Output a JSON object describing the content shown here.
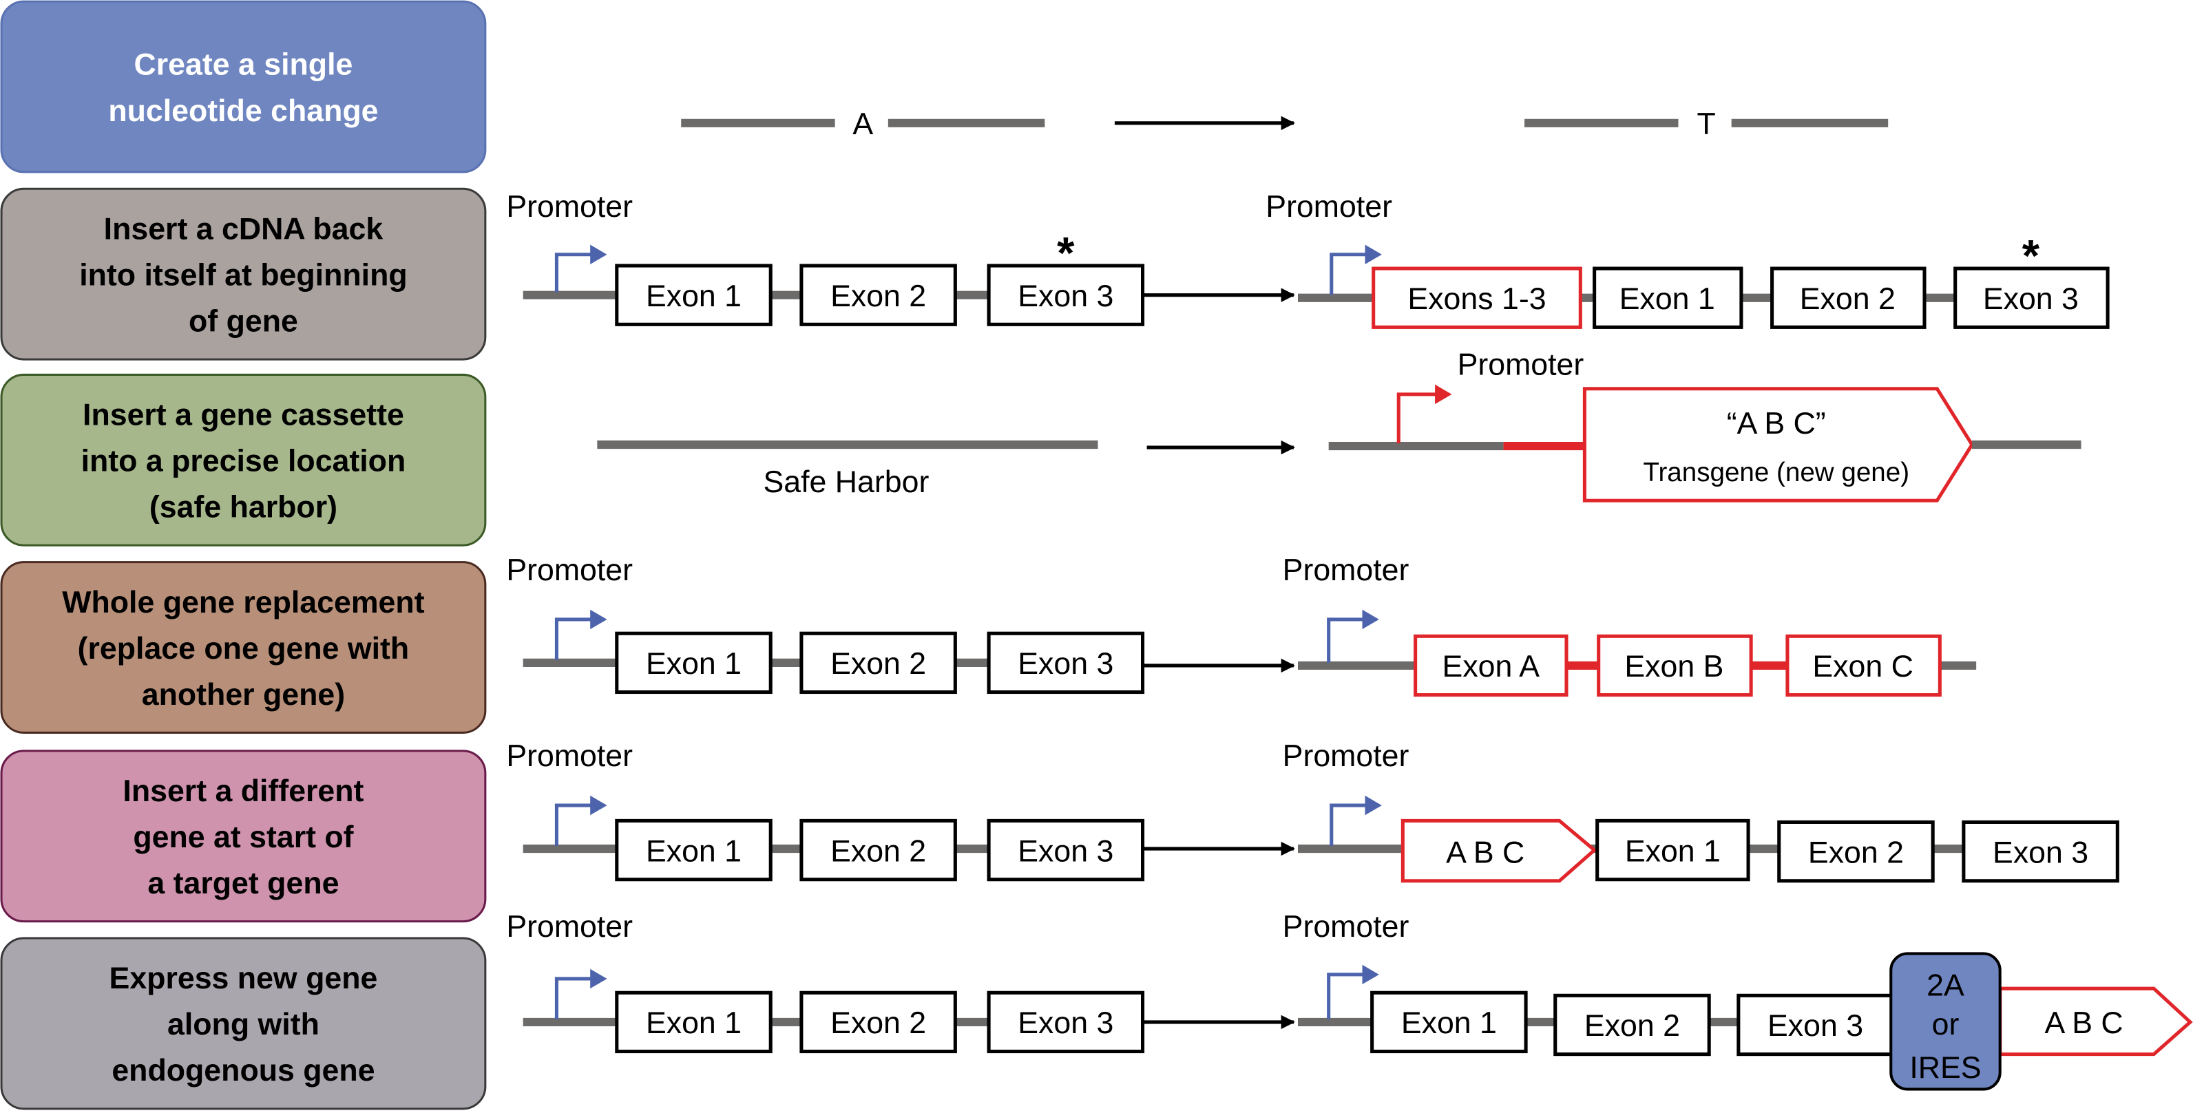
{
  "categories": [
    {
      "label_lines": [
        "Create a single",
        "nucleotide change"
      ],
      "fill": "#6f86c0",
      "stroke": "#5a72b2",
      "text_color": "#ffffff"
    },
    {
      "label_lines": [
        "Insert a cDNA back",
        "into itself at beginning",
        "of gene"
      ],
      "fill": "#aaa29f",
      "stroke": "#3a3a3a",
      "text_color": "#000000"
    },
    {
      "label_lines": [
        "Insert a gene cassette",
        "into a precise location",
        "(safe harbor)"
      ],
      "fill": "#a6b78b",
      "stroke": "#3b5a25",
      "text_color": "#000000"
    },
    {
      "label_lines": [
        "Whole gene replacement",
        "(replace one gene with",
        "another gene)"
      ],
      "fill": "#b8907a",
      "stroke": "#4a2a20",
      "text_color": "#000000"
    },
    {
      "label_lines": [
        "Insert a different",
        "gene at start of",
        "a target gene"
      ],
      "fill": "#cf93ad",
      "stroke": "#6a1a4a",
      "text_color": "#000000"
    },
    {
      "label_lines": [
        "Express new gene",
        "along with",
        "endogenous gene"
      ],
      "fill": "#aaa6ad",
      "stroke": "#3a3a3a",
      "text_color": "#000000"
    }
  ],
  "labels": {
    "promoter": "Promoter",
    "base_before": "A",
    "base_after": "T",
    "exon1": "Exon 1",
    "exon2": "Exon 2",
    "exon3": "Exon 3",
    "exons13": "Exons 1-3",
    "mutation_mark": "*",
    "safe_harbor": "Safe Harbor",
    "transgene_name": "“A B C”",
    "transgene_desc": "Transgene (new gene)",
    "exonA": "Exon A",
    "exonB": "Exon B",
    "exonC": "Exon C",
    "abc": "A B C",
    "linker_top": "2A",
    "linker_mid": "or",
    "linker_bottom": "IRES"
  },
  "colors": {
    "dna": "#6d6b6a",
    "promoter_endogenous": "#4d64ad",
    "new_element": "#e0262a",
    "linker": "#6f86c0"
  }
}
